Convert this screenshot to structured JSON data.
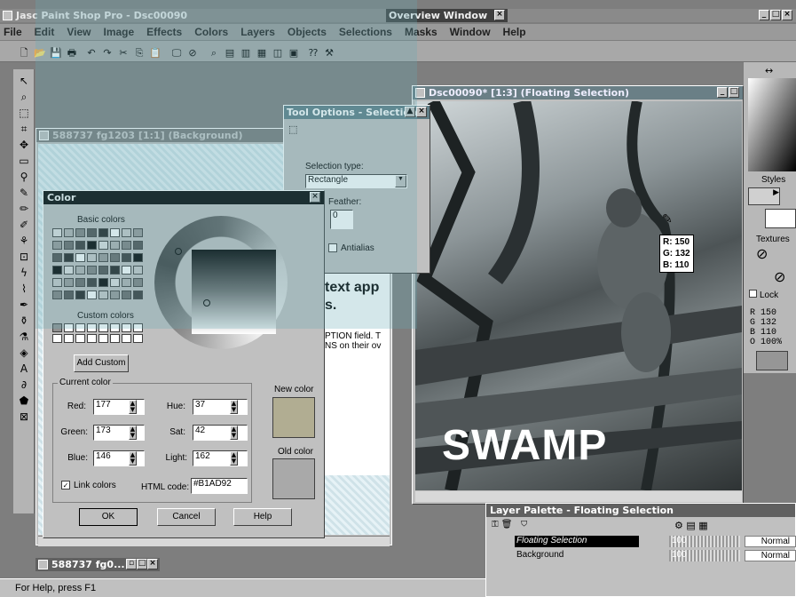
{
  "app": {
    "title": "Jasc Paint Shop Pro - Dsc00090",
    "status": "For Help, press F1"
  },
  "menu": [
    "File",
    "Edit",
    "View",
    "Image",
    "Effects",
    "Colors",
    "Layers",
    "Objects",
    "Selections",
    "Masks",
    "Window",
    "Help"
  ],
  "overview": {
    "title": "Overview Window"
  },
  "bg_window": {
    "title": "588737 fg1203 [1:1] (Background)",
    "text1": "text app",
    "text2": "s.",
    "text3": "PTION field. T",
    "text4": "NS on their ov"
  },
  "mini_window": {
    "title": "588737 fg0..."
  },
  "tool_options": {
    "title": "Tool Options - Selection",
    "sel_type_label": "Selection type:",
    "sel_type": "Rectangle",
    "feather_label": "Feather:",
    "feather": "0",
    "antialias": "Antialias"
  },
  "photo_window": {
    "title": "Dsc00090* [1:3] (Floating Selection)",
    "overlay_text": "SWAMP",
    "r": "R: 150",
    "g": "G: 132",
    "b": "B: 110"
  },
  "color_dialog": {
    "title": "Color",
    "basic_colors": "Basic colors",
    "custom_colors": "Custom colors",
    "add_custom": "Add Custom",
    "current_color": "Current color",
    "new_color": "New color",
    "old_color": "Old color",
    "red_label": "Red:",
    "red": "177",
    "green_label": "Green:",
    "green": "173",
    "blue_label": "Blue:",
    "blue": "146",
    "hue_label": "Hue:",
    "hue": "37",
    "sat_label": "Sat:",
    "sat": "42",
    "light_label": "Light:",
    "light": "162",
    "link_colors": "Link colors",
    "html_label": "HTML code:",
    "html": "#B1AD92",
    "ok": "OK",
    "cancel": "Cancel",
    "help": "Help"
  },
  "layer_palette": {
    "title": "Layer Palette - Floating Selection",
    "layers": [
      {
        "name": "Floating Selection",
        "opacity": "100",
        "mode": "Normal"
      },
      {
        "name": "Background",
        "opacity": "100",
        "mode": "Normal"
      }
    ]
  },
  "right_panel": {
    "styles": "Styles",
    "textures": "Textures",
    "lock": "Lock",
    "r": "R   150",
    "g": "G   132",
    "b": "B   110",
    "o": "O   100%"
  },
  "colors": {
    "title_active": "#000000",
    "face": "#c0c0c0",
    "workspace": "#7e7e7e",
    "new_color": "#b1ad92"
  }
}
